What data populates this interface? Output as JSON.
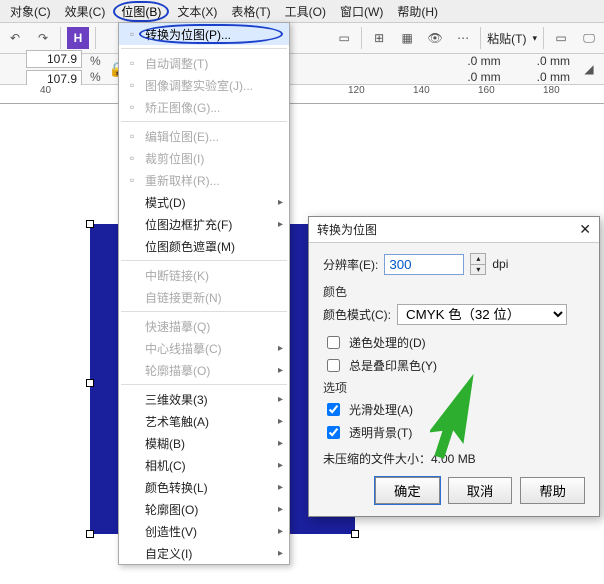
{
  "menubar": {
    "items": [
      "对象(C)",
      "效果(C)",
      "位图(B)",
      "文本(X)",
      "表格(T)",
      "工具(O)",
      "窗口(W)",
      "帮助(H)"
    ],
    "selected_index": 2
  },
  "toolbar": {
    "paste_label": "粘贴(T)"
  },
  "propbar": {
    "scale_x": "107.9",
    "scale_y": "107.9",
    "mm_values": [
      ".0 mm",
      ".0 mm",
      ".0 mm",
      ".0 mm"
    ]
  },
  "ruler": {
    "labels": [
      "40",
      "120",
      "140",
      "160",
      "180"
    ]
  },
  "dropdown": {
    "items": [
      {
        "label": "转换为位图(P)...",
        "enabled": true,
        "highlight": true,
        "icon": "convert",
        "oval": true
      },
      {
        "sep": true
      },
      {
        "label": "自动调整(T)",
        "enabled": false,
        "icon": "auto"
      },
      {
        "label": "图像调整实验室(J)...",
        "enabled": false,
        "icon": "lab"
      },
      {
        "label": "矫正图像(G)...",
        "enabled": false,
        "icon": "straighten"
      },
      {
        "sep": true
      },
      {
        "label": "编辑位图(E)...",
        "enabled": false,
        "icon": "edit"
      },
      {
        "label": "裁剪位图(I)",
        "enabled": false,
        "icon": "crop"
      },
      {
        "label": "重新取样(R)...",
        "enabled": false,
        "icon": "resample"
      },
      {
        "label": "模式(D)",
        "enabled": true,
        "sub": true
      },
      {
        "label": "位图边框扩充(F)",
        "enabled": true,
        "sub": true
      },
      {
        "label": "位图颜色遮罩(M)",
        "enabled": true
      },
      {
        "sep": true
      },
      {
        "label": "中断链接(K)",
        "enabled": false
      },
      {
        "label": "自链接更新(N)",
        "enabled": false
      },
      {
        "sep": true
      },
      {
        "label": "快速描摹(Q)",
        "enabled": false
      },
      {
        "label": "中心线描摹(C)",
        "enabled": false,
        "sub": true
      },
      {
        "label": "轮廓描摹(O)",
        "enabled": false,
        "sub": true
      },
      {
        "sep": true
      },
      {
        "label": "三维效果(3)",
        "enabled": true,
        "sub": true
      },
      {
        "label": "艺术笔触(A)",
        "enabled": true,
        "sub": true
      },
      {
        "label": "模糊(B)",
        "enabled": true,
        "sub": true
      },
      {
        "label": "相机(C)",
        "enabled": true,
        "sub": true
      },
      {
        "label": "颜色转换(L)",
        "enabled": true,
        "sub": true
      },
      {
        "label": "轮廓图(O)",
        "enabled": true,
        "sub": true
      },
      {
        "label": "创造性(V)",
        "enabled": true,
        "sub": true
      },
      {
        "label": "自定义(I)",
        "enabled": true,
        "sub": true
      }
    ]
  },
  "dialog": {
    "title": "转换为位图",
    "resolution_label": "分辨率(E):",
    "resolution_value": "300",
    "resolution_unit": "dpi",
    "group_color": "颜色",
    "colormode_label": "颜色模式(C):",
    "colormode_value": "CMYK 色（32 位）",
    "chk_dither": "递色处理的(D)",
    "chk_overprint": "总是叠印黑色(Y)",
    "group_options": "选项",
    "chk_smooth": "光滑处理(A)",
    "chk_transparent": "透明背景(T)",
    "size_label": "未压缩的文件大小：4.00 MB",
    "btn_ok": "确定",
    "btn_cancel": "取消",
    "btn_help": "帮助"
  }
}
